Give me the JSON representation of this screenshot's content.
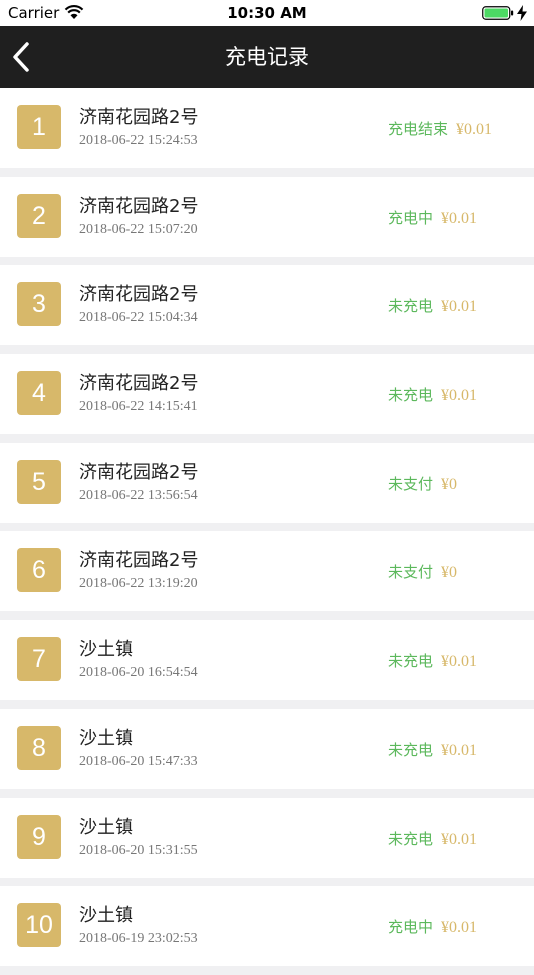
{
  "status_bar": {
    "carrier": "Carrier",
    "time": "10:30 AM"
  },
  "nav": {
    "title": "充电记录"
  },
  "records": [
    {
      "index": "1",
      "name": "济南花园路2号",
      "time": "2018-06-22 15:24:53",
      "status": "充电结束",
      "price": "¥0.01"
    },
    {
      "index": "2",
      "name": "济南花园路2号",
      "time": "2018-06-22 15:07:20",
      "status": "充电中",
      "price": "¥0.01"
    },
    {
      "index": "3",
      "name": "济南花园路2号",
      "time": "2018-06-22 15:04:34",
      "status": "未充电",
      "price": "¥0.01"
    },
    {
      "index": "4",
      "name": "济南花园路2号",
      "time": "2018-06-22 14:15:41",
      "status": "未充电",
      "price": "¥0.01"
    },
    {
      "index": "5",
      "name": "济南花园路2号",
      "time": "2018-06-22 13:56:54",
      "status": "未支付",
      "price": "¥0"
    },
    {
      "index": "6",
      "name": "济南花园路2号",
      "time": "2018-06-22 13:19:20",
      "status": "未支付",
      "price": "¥0"
    },
    {
      "index": "7",
      "name": "沙土镇",
      "time": "2018-06-20 16:54:54",
      "status": "未充电",
      "price": "¥0.01"
    },
    {
      "index": "8",
      "name": "沙土镇",
      "time": "2018-06-20 15:47:33",
      "status": "未充电",
      "price": "¥0.01"
    },
    {
      "index": "9",
      "name": "沙土镇",
      "time": "2018-06-20 15:31:55",
      "status": "未充电",
      "price": "¥0.01"
    },
    {
      "index": "10",
      "name": "沙土镇",
      "time": "2018-06-19 23:02:53",
      "status": "充电中",
      "price": "¥0.01"
    }
  ],
  "colors": {
    "nav_background": "#1f1f1f",
    "badge": "#d7b86a",
    "status_green": "#5cb85c",
    "price_gold": "#d7b86a",
    "battery_green": "#4cd964"
  },
  "icons": {
    "back": "chevron-left-icon",
    "wifi": "wifi-icon",
    "battery": "battery-icon",
    "charging": "bolt-icon"
  }
}
